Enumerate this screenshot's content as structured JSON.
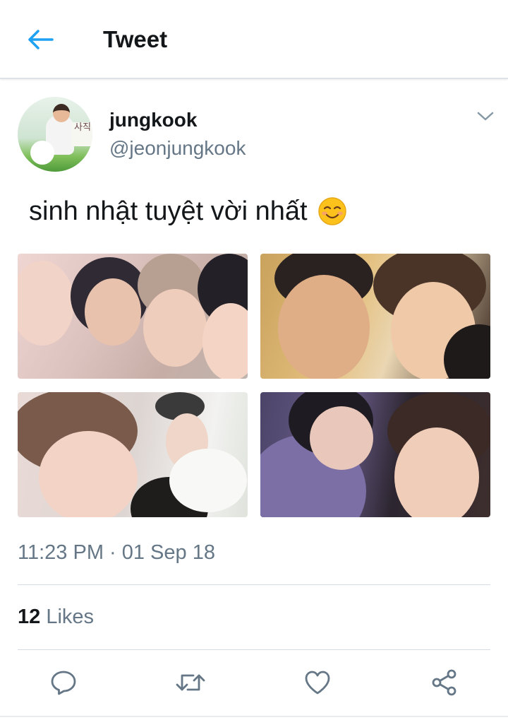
{
  "header": {
    "title": "Tweet",
    "back_icon": "arrow-left-icon",
    "accent_color": "#1da1f2"
  },
  "tweet": {
    "author": {
      "display_name": "jungkook",
      "handle": "@jeonjungkook",
      "avatar_sign_text": "사직"
    },
    "text": "sinh nhật tuyệt vời nhất",
    "emoji": "smiling-face-emoji",
    "photos": [
      {
        "name": "group-selfie-photo"
      },
      {
        "name": "duo-selfie-photo"
      },
      {
        "name": "close-up-selfie-photo"
      },
      {
        "name": "purple-jacket-selfie-photo"
      }
    ],
    "timestamp": "11:23 PM · 01 Sep 18",
    "likes": {
      "count": "12",
      "label": "Likes"
    }
  },
  "actions": [
    {
      "name": "reply-icon"
    },
    {
      "name": "retweet-icon"
    },
    {
      "name": "like-icon"
    },
    {
      "name": "share-icon"
    }
  ]
}
